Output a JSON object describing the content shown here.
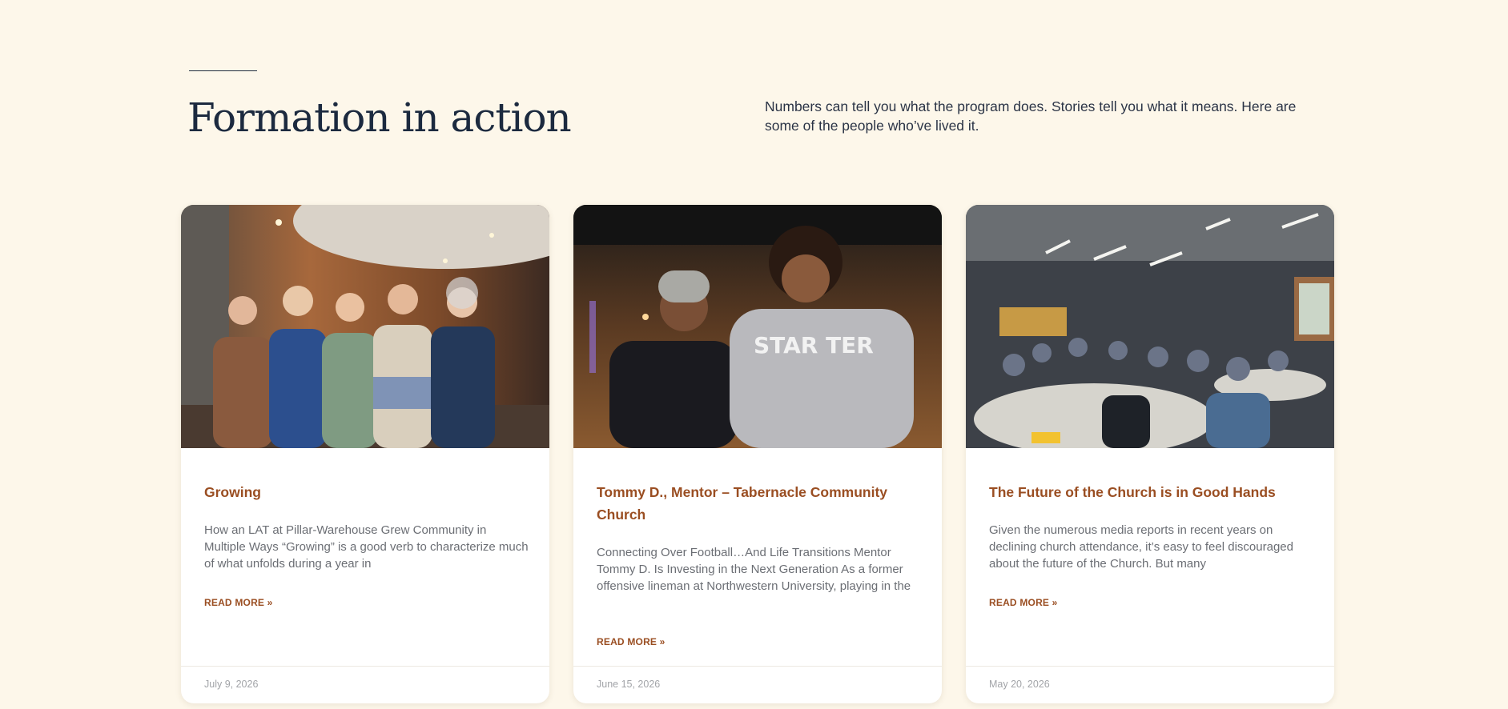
{
  "section": {
    "title": "Formation in action",
    "intro": "Numbers can tell you what the program does. Stories tell you what it means. Here are some of the people who’ve lived it."
  },
  "cards": [
    {
      "image_alt": "Five women standing together in a lobby",
      "title": "Growing",
      "excerpt": "How an LAT at Pillar-Warehouse Grew Community in Multiple Ways “Growing” is a good verb to characterize much of what unfolds during a year in",
      "read_more": "READ MORE »",
      "date": "July 9, 2026"
    },
    {
      "image_alt": "A young woman and a young man smiling side by side",
      "title": "Tommy D., Mentor – Tabernacle Community Church",
      "excerpt": "Connecting Over Football…And Life Transitions Mentor Tommy D. Is Investing in the Next Generation As a former offensive lineman at Northwestern University, playing in the",
      "read_more": "READ MORE »",
      "date": "June 15, 2026"
    },
    {
      "image_alt": "Group of people seated at round tables in a meeting room",
      "title": "The Future of the Church is in Good Hands",
      "excerpt": "Given the numerous media reports in recent years on declining church attendance, it’s easy to feel discouraged about the future of the Church. But many",
      "read_more": "READ MORE »",
      "date": "May 20, 2026"
    }
  ],
  "colors": {
    "background": "#fdf7ea",
    "heading": "#1c2a3f",
    "accent": "#9a4e22",
    "body_text": "#6b6e74",
    "muted": "#a2a4a8"
  }
}
